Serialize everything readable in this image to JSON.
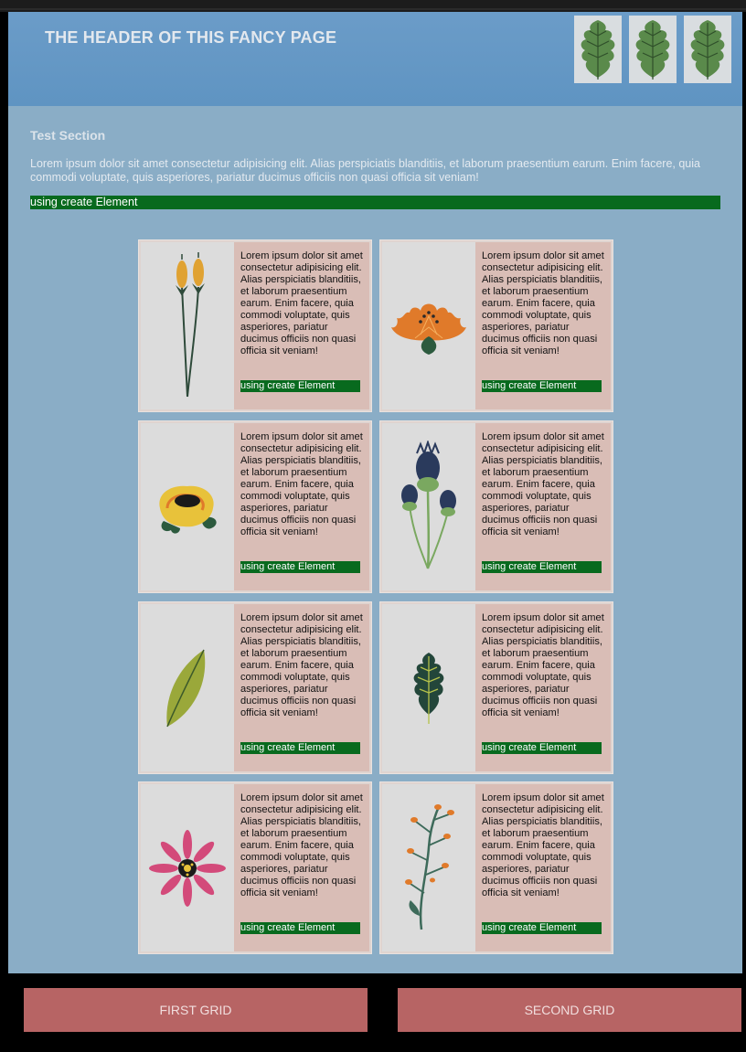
{
  "header": {
    "title": "THE HEADER OF THIS FANCY PAGE"
  },
  "header_icons": [
    "leaf-icon",
    "leaf-icon",
    "leaf-icon"
  ],
  "section": {
    "title": "Test Section",
    "text": "Lorem ipsum dolor sit amet consectetur adipisicing elit. Alias perspiciatis blanditiis, et laborum praesentium earum. Enim facere, quia commodi voluptate, quis asperiores, pariatur ducimus officiis non quasi officia sit veniam!",
    "button_label": "using create Element"
  },
  "cards": [
    {
      "icon": "cattail-plant-icon",
      "text": "Lorem ipsum dolor sit amet consectetur adipisicing elit. Alias perspiciatis blanditiis, et laborum praesentium earum. Enim facere, quia commodi voluptate, quis asperiores, pariatur ducimus officiis non quasi officia sit veniam!",
      "button": "using create Element"
    },
    {
      "icon": "orange-flower-icon",
      "text": "Lorem ipsum dolor sit amet consectetur adipisicing elit. Alias perspiciatis blanditiis, et laborum praesentium earum. Enim facere, quia commodi voluptate, quis asperiores, pariatur ducimus officiis non quasi officia sit veniam!",
      "button": "using create Element"
    },
    {
      "icon": "yellow-rose-icon",
      "text": "Lorem ipsum dolor sit amet consectetur adipisicing elit. Alias perspiciatis blanditiis, et laborum praesentium earum. Enim facere, quia commodi voluptate, quis asperiores, pariatur ducimus officiis non quasi officia sit veniam!",
      "button": "using create Element"
    },
    {
      "icon": "thistle-icon",
      "text": "Lorem ipsum dolor sit amet consectetur adipisicing elit. Alias perspiciatis blanditiis, et laborum praesentium earum. Enim facere, quia commodi voluptate, quis asperiores, pariatur ducimus officiis non quasi officia sit veniam!",
      "button": "using create Element"
    },
    {
      "icon": "green-leaf-icon",
      "text": "Lorem ipsum dolor sit amet consectetur adipisicing elit. Alias perspiciatis blanditiis, et laborum praesentium earum. Enim facere, quia commodi voluptate, quis asperiores, pariatur ducimus officiis non quasi officia sit veniam!",
      "button": "using create Element"
    },
    {
      "icon": "oak-leaf-icon",
      "text": "Lorem ipsum dolor sit amet consectetur adipisicing elit. Alias perspiciatis blanditiis, et laborum praesentium earum. Enim facere, quia commodi voluptate, quis asperiores, pariatur ducimus officiis non quasi officia sit veniam!",
      "button": "using create Element"
    },
    {
      "icon": "pink-daisy-icon",
      "text": "Lorem ipsum dolor sit amet consectetur adipisicing elit. Alias perspiciatis blanditiis, et laborum praesentium earum. Enim facere, quia commodi voluptate, quis asperiores, pariatur ducimus officiis non quasi officia sit veniam!",
      "button": "using create Element"
    },
    {
      "icon": "berry-branch-icon",
      "text": "Lorem ipsum dolor sit amet consectetur adipisicing elit. Alias perspiciatis blanditiis, et laborum praesentium earum. Enim facere, quia commodi voluptate, quis asperiores, pariatur ducimus officiis non quasi officia sit veniam!",
      "button": "using create Element"
    }
  ],
  "footer": {
    "first_label": "FIRST GRID",
    "second_label": "SECOND GRID"
  },
  "colors": {
    "page_bg": "#8aadc6",
    "header_bg": "#6b9cc8",
    "accent_green": "#086a1e",
    "card_text_bg": "#d9bdb6",
    "footer_button": "#b76464"
  }
}
